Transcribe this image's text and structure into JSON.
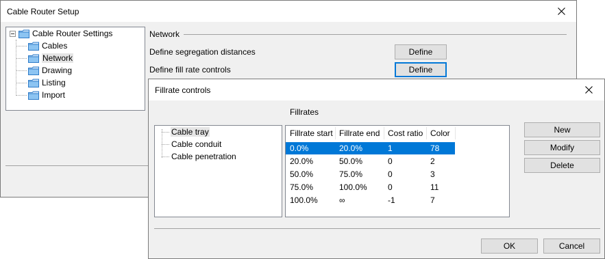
{
  "setup": {
    "title": "Cable Router Setup",
    "tree": {
      "root": "Cable Router Settings",
      "items": [
        "Cables",
        "Network",
        "Drawing",
        "Listing",
        "Import"
      ]
    },
    "section_title": "Network",
    "rows": [
      {
        "label": "Define segregation distances",
        "button": "Define"
      },
      {
        "label": "Define fill rate controls",
        "button": "Define"
      }
    ]
  },
  "fillrate": {
    "title": "Fillrate controls",
    "section_title": "Fillrates",
    "tree_items": [
      "Cable tray",
      "Cable conduit",
      "Cable penetration"
    ],
    "columns": [
      "Fillrate start",
      "Fillrate end",
      "Cost ratio",
      "Color"
    ],
    "rows": [
      [
        "0.0%",
        "20.0%",
        "1",
        "78"
      ],
      [
        "20.0%",
        "50.0%",
        "0",
        "2"
      ],
      [
        "50.0%",
        "75.0%",
        "0",
        "3"
      ],
      [
        "75.0%",
        "100.0%",
        "0",
        "11"
      ],
      [
        "100.0%",
        "∞",
        "-1",
        "7"
      ]
    ],
    "buttons": {
      "new": "New",
      "modify": "Modify",
      "delete": "Delete",
      "ok": "OK",
      "cancel": "Cancel"
    }
  },
  "colors": {
    "selection": "#0078d7",
    "dialog_bg": "#f0f0f0",
    "folder": "#f5cf6a"
  }
}
